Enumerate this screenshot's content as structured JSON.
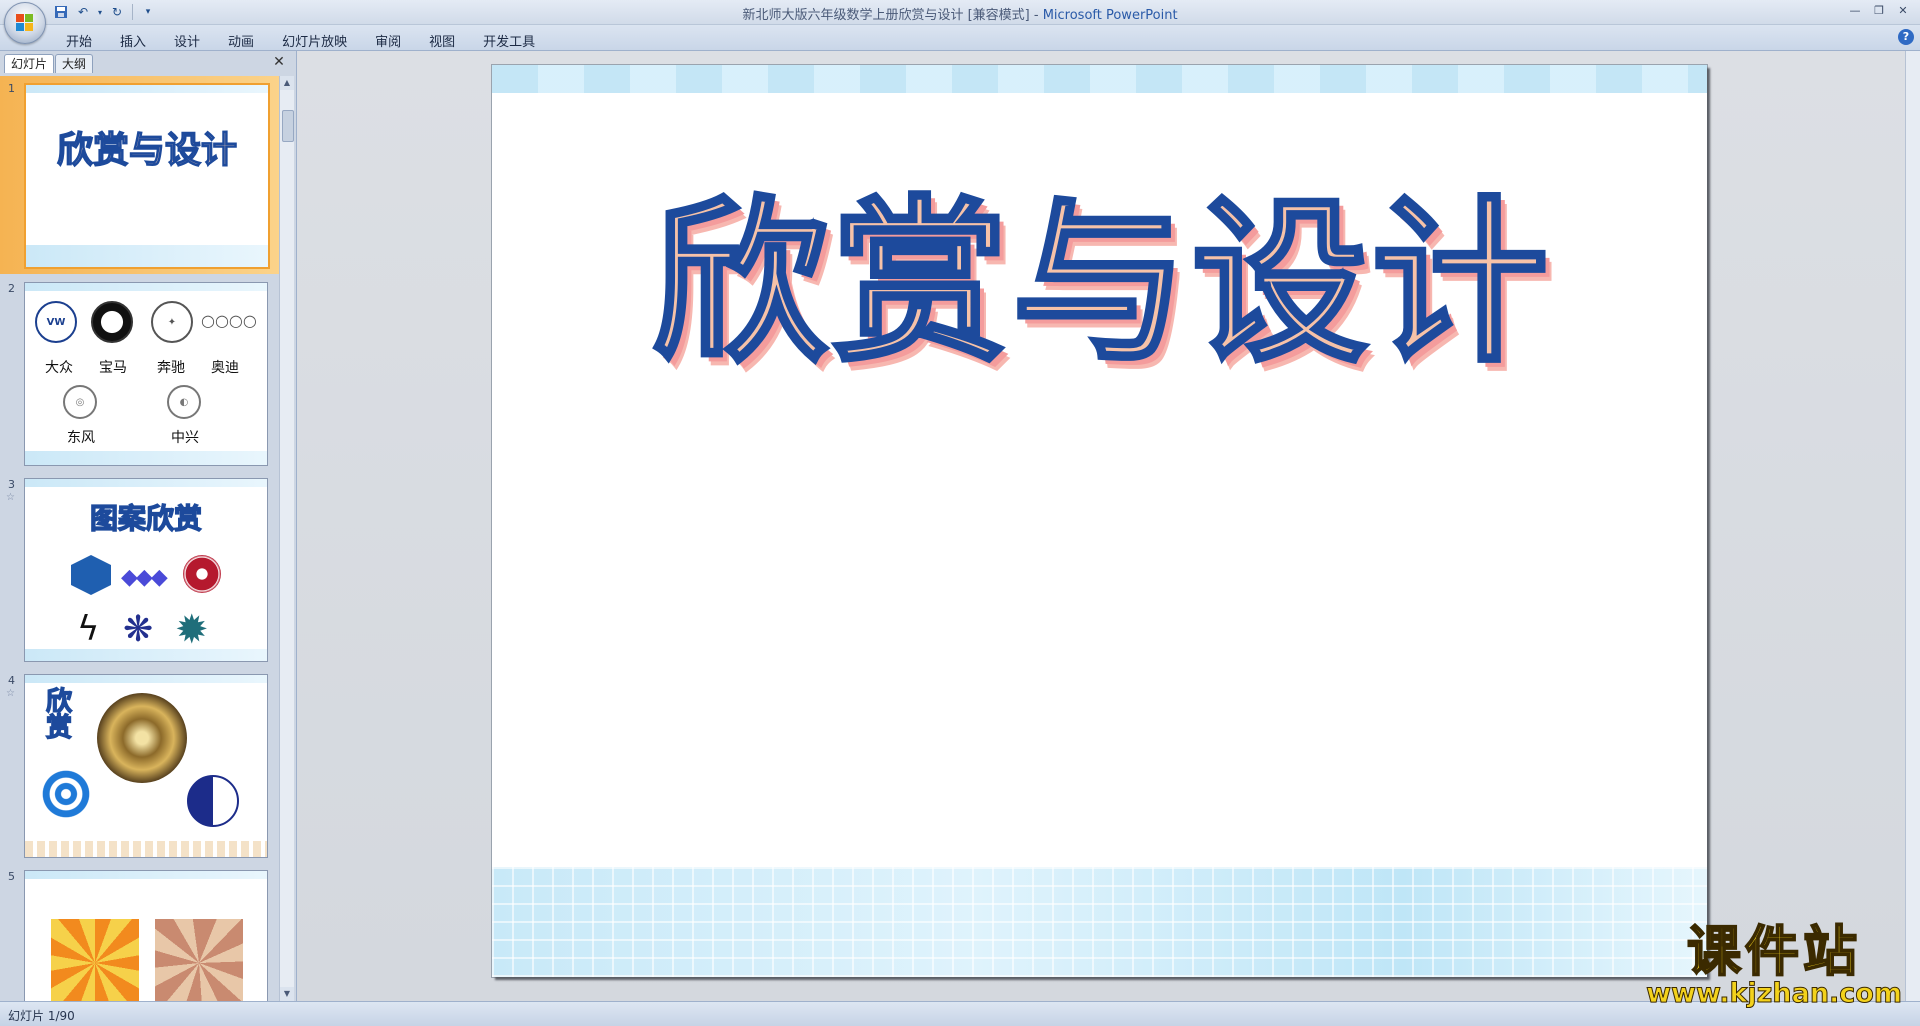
{
  "window": {
    "title": "新北师大版六年级数学上册欣赏与设计 [兼容模式]",
    "title_sep": " - ",
    "app_name": "Microsoft PowerPoint"
  },
  "ribbon": {
    "tabs": [
      "开始",
      "插入",
      "设计",
      "动画",
      "幻灯片放映",
      "审阅",
      "视图",
      "开发工具"
    ]
  },
  "left_panel": {
    "tab_slides": "幻灯片",
    "tab_outline": "大纲",
    "close_glyph": "✕"
  },
  "thumbnails": [
    {
      "num": "1",
      "title": "欣赏与设计"
    },
    {
      "num": "2",
      "logos": [
        "大众",
        "宝马",
        "奔驰",
        "奥迪",
        "东风",
        "中兴"
      ]
    },
    {
      "num": "3",
      "title": "图案欣赏"
    },
    {
      "num": "4",
      "title": "欣赏"
    },
    {
      "num": "5"
    }
  ],
  "slide": {
    "title": "欣赏与设计"
  },
  "status": {
    "slide_counter": "幻灯片 1/90"
  },
  "watermark": {
    "line1": "课件站",
    "line2": "www.kjzhan.com"
  },
  "icons": [
    "office-button-icon",
    "save-icon",
    "undo-icon",
    "redo-icon",
    "customize-icon",
    "minimize-icon",
    "restore-icon",
    "close-icon",
    "help-icon"
  ]
}
